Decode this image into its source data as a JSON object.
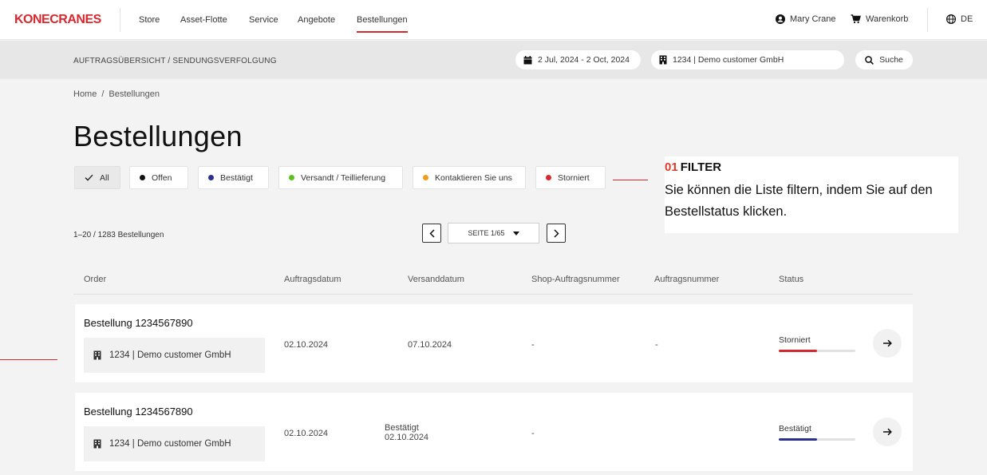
{
  "brand": {
    "logo": "KONECRANES",
    "accent": "#d7282f"
  },
  "nav": {
    "items": [
      "Store",
      "Asset-Flotte",
      "Service",
      "Angebote",
      "Bestellungen"
    ],
    "active": "Bestellungen",
    "user": "Mary Crane",
    "cart": "Warenkorb",
    "language": "DE"
  },
  "subbar": {
    "title": "AUFTRAGSÜBERSICHT / SENDUNGSVERFOLGUNG",
    "date_range": "2 Jul, 2024 - 2 Oct, 2024",
    "customer": "1234 | Demo customer GmbH",
    "search": "Suche"
  },
  "breadcrumb": {
    "home": "Home",
    "sep": "/",
    "current": "Bestellungen"
  },
  "page": {
    "title": "Bestellungen"
  },
  "filters": [
    {
      "label": "All",
      "color": null,
      "selected": true
    },
    {
      "label": "Offen",
      "color": "#111111",
      "selected": false
    },
    {
      "label": "Bestätigt",
      "color": "#2b2f8f",
      "selected": false
    },
    {
      "label": "Versandt / Teillieferung",
      "color": "#5cc01f",
      "selected": false
    },
    {
      "label": "Kontaktieren Sie uns",
      "color": "#f29a1a",
      "selected": false
    },
    {
      "label": "Storniert",
      "color": "#d7282f",
      "selected": false
    }
  ],
  "callout": {
    "number": "01",
    "title": "FILTER",
    "text": "Sie können die Liste filtern, indem Sie auf den Bestellstatus klicken."
  },
  "list": {
    "count": "1–20 / 1283 Bestellungen",
    "page": "SEITE 1/65",
    "columns": [
      "Order",
      "Auftragsdatum",
      "Versanddatum",
      "Shop-Auftragsnummer",
      "Auftragsnummer",
      "Status"
    ]
  },
  "orders": [
    {
      "title": "Bestellung 1234567890",
      "customer": "1234 | Demo customer GmbH",
      "order_date": "02.10.2024",
      "ship_status": "",
      "ship_date": "07.10.2024",
      "shop_number": "-",
      "order_number": "-",
      "status": "Storniert",
      "status_color": "#d7282f",
      "status_progress": 0.5
    },
    {
      "title": "Bestellung 1234567890",
      "customer": "1234 | Demo customer GmbH",
      "order_date": "02.10.2024",
      "ship_status": "Bestätigt",
      "ship_date": "02.10.2024",
      "shop_number": "-",
      "order_number": "",
      "status": "Bestätigt",
      "status_color": "#2b2f8f",
      "status_progress": 0.5
    }
  ]
}
